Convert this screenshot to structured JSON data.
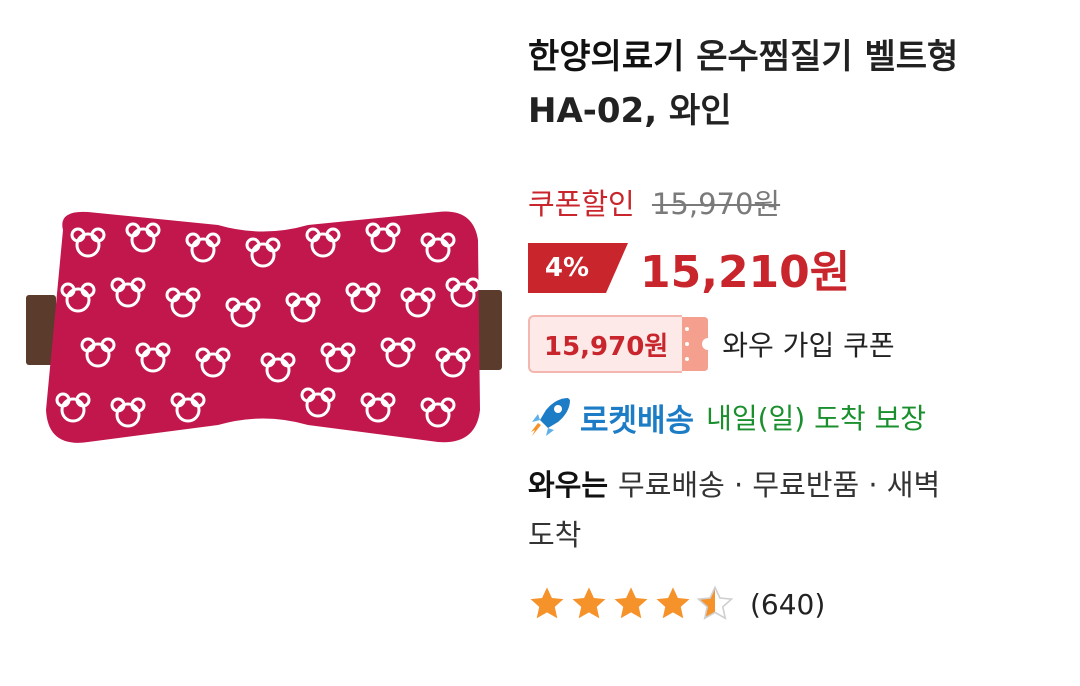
{
  "product": {
    "brand": "한양의료기",
    "title_line1": "온수찜질기 벨트형",
    "title_line2": "HA-02, 와인",
    "image_alt": "wine-colored belt-type hot water compress pad"
  },
  "pricing": {
    "coupon_label": "쿠폰할인",
    "original_price": "15,970원",
    "discount_percent": "4%",
    "sale_price": "15,210원",
    "member_coupon_price": "15,970원",
    "member_coupon_label": "와우 가입 쿠폰"
  },
  "delivery": {
    "rocket_label": "로켓배송",
    "arrival_text": "내일(일) 도착 보장"
  },
  "wow": {
    "label": "와우는",
    "benefits_line1": "무료배송 · 무료반품 · 새벽",
    "benefits_line2": "도착"
  },
  "rating": {
    "stars": 4.5,
    "review_count": "(640)"
  },
  "colors": {
    "accent_red": "#c8252c",
    "rocket_blue": "#1d7cc6",
    "delivery_green": "#1a8f2d",
    "star_orange": "#f5922a",
    "product_wine": "#c1174d"
  }
}
